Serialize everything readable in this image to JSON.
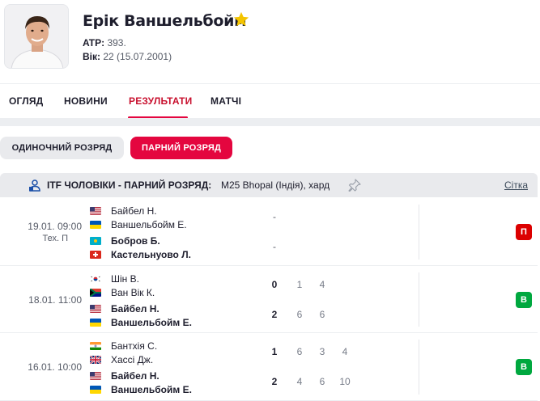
{
  "player": {
    "name": "Ерік Ваншельбойм",
    "atp_label": "ATP:",
    "atp_value": "393.",
    "age_label": "Вік:",
    "age_value": "22 (15.07.2001)",
    "favorite_icon": "star-icon",
    "favorite_color": "#f4c400"
  },
  "tabs": [
    {
      "label": "ОГЛЯД",
      "active": false
    },
    {
      "label": "НОВИНИ",
      "active": false
    },
    {
      "label": "РЕЗУЛЬТАТИ",
      "active": true
    },
    {
      "label": "МАТЧІ",
      "active": false
    }
  ],
  "filters": {
    "single_label": "ОДИНОЧНИЙ РОЗРЯД",
    "double_label": "ПАРНИЙ РОЗРЯД",
    "selected": "double"
  },
  "tournament": {
    "title": "ITF ЧОЛОВІКИ - ПАРНИЙ РОЗРЯД:",
    "subtitle": "M25 Bhopal (Індія), хард",
    "link_label": "Сітка",
    "icon": "person-icon",
    "pin_icon": "pin-icon"
  },
  "colors": {
    "accent": "#e4063f",
    "win": "#00a83f",
    "loss": "#dc0000"
  },
  "matches": [
    {
      "time": "19.01. 09:00",
      "status": "Тех. П",
      "team1": {
        "p1": {
          "name": "Байбел Н.",
          "flag": "us"
        },
        "p2": {
          "name": "Ваншельбойм Е.",
          "flag": "ua"
        },
        "winner": false,
        "total": "-",
        "sets": []
      },
      "team2": {
        "p1": {
          "name": "Бобров Б.",
          "flag": "kz"
        },
        "p2": {
          "name": "Кастельнуово Л.",
          "flag": "ch"
        },
        "winner": true,
        "total": "-",
        "sets": []
      },
      "result": "П"
    },
    {
      "time": "18.01. 11:00",
      "status": "",
      "team1": {
        "p1": {
          "name": "Шін В.",
          "flag": "kr"
        },
        "p2": {
          "name": "Ван Вік К.",
          "flag": "za"
        },
        "winner": false,
        "total": "0",
        "sets": [
          "1",
          "4"
        ]
      },
      "team2": {
        "p1": {
          "name": "Байбел Н.",
          "flag": "us"
        },
        "p2": {
          "name": "Ваншельбойм Е.",
          "flag": "ua"
        },
        "winner": true,
        "total": "2",
        "sets": [
          "6",
          "6"
        ]
      },
      "result": "В"
    },
    {
      "time": "16.01. 10:00",
      "status": "",
      "team1": {
        "p1": {
          "name": "Бантхія С.",
          "flag": "in"
        },
        "p2": {
          "name": "Хассі Дж.",
          "flag": "gb"
        },
        "winner": false,
        "total": "1",
        "sets": [
          "6",
          "3",
          "4"
        ]
      },
      "team2": {
        "p1": {
          "name": "Байбел Н.",
          "flag": "us"
        },
        "p2": {
          "name": "Ваншельбойм Е.",
          "flag": "ua"
        },
        "winner": true,
        "total": "2",
        "sets": [
          "4",
          "6",
          "10"
        ]
      },
      "result": "В"
    }
  ]
}
